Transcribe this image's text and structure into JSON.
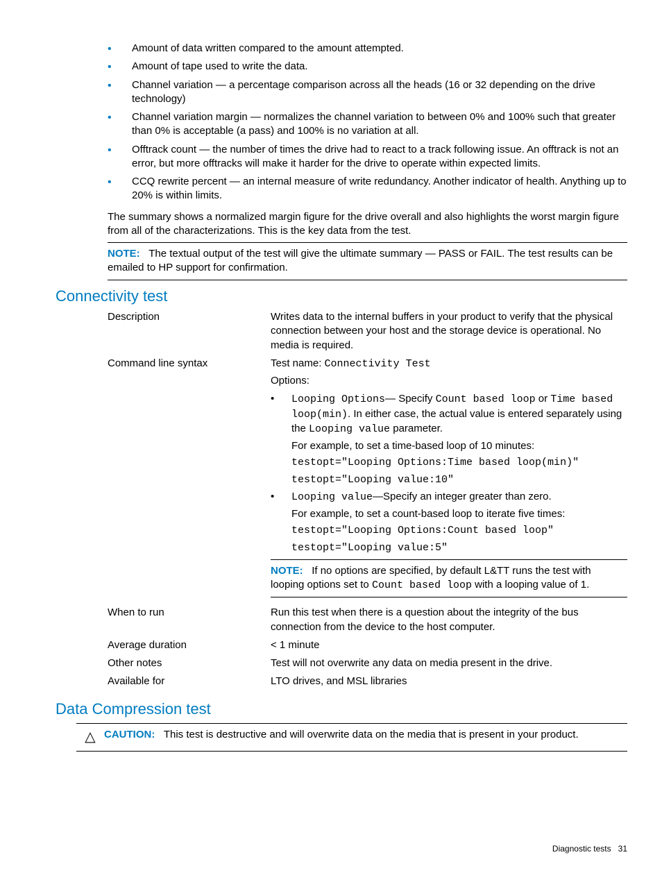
{
  "bullets": [
    "Amount of data written compared to the amount attempted.",
    "Amount of tape used to write the data.",
    "Channel variation — a percentage comparison across all the heads (16 or 32 depending on the drive technology)",
    "Channel variation margin — normalizes the channel variation to between 0% and 100% such that greater than 0% is acceptable (a pass) and 100% is no variation at all.",
    "Offtrack count — the number of times the drive had to react to a track following issue. An offtrack is not an error, but more offtracks will make it harder for the drive to operate within expected limits.",
    "CCQ rewrite percent — an internal measure of write redundancy. Another indicator of health. Anything up to 20% is within limits."
  ],
  "summary": "The summary shows a normalized margin figure for the drive overall and also highlights the worst margin figure from all of the characterizations. This is the key data from the test.",
  "note1": {
    "label": "NOTE:",
    "text": "The textual output of the test will give the ultimate summary — PASS or FAIL. The test results can be emailed to HP support for confirmation."
  },
  "conn": {
    "heading": "Connectivity test",
    "desc_label": "Description",
    "desc_value": "Writes data to the internal buffers in your product to verify that the physical connection between your host and the storage device is operational. No media is required.",
    "cmd_label": "Command line syntax",
    "cmd_line1_a": "Test name: ",
    "cmd_line1_b": "Connectivity Test",
    "cmd_line2": "Options:",
    "opt1": {
      "a": "Looping Options",
      "b": "— Specify ",
      "c": "Count based loop",
      "d": " or ",
      "e": "Time based loop(min)",
      "f": ". In either case, the actual value is entered separately using the ",
      "g": "Looping value",
      "h": " parameter.",
      "ex_intro": "For example, to set a time-based loop of 10 minutes:",
      "ex1": "testopt=\"Looping Options:Time based loop(min)\"",
      "ex2": "testopt=\"Looping value:10\""
    },
    "opt2": {
      "a": "Looping value",
      "b": "—Specify an integer greater than zero.",
      "ex_intro": "For example, to set a count-based loop to iterate five times:",
      "ex1": "testopt=\"Looping Options:Count based loop\"",
      "ex2": "testopt=\"Looping value:5\""
    },
    "note": {
      "label": "NOTE:",
      "a": "If no options are specified, by default L&TT runs the test with looping options set to ",
      "b": "Count based loop",
      "c": " with a looping value of 1."
    },
    "when_label": "When to run",
    "when_value": "Run this test when there is a question about the integrity of the bus connection from the device to the host computer.",
    "dur_label": "Average duration",
    "dur_value": "< 1 minute",
    "notes_label": "Other notes",
    "notes_value": "Test will not overwrite any data on media present in the drive.",
    "avail_label": "Available for",
    "avail_value": "LTO drives, and MSL libraries"
  },
  "dct": {
    "heading": "Data Compression test",
    "caution_label": "CAUTION:",
    "caution_text": "This test is destructive and will overwrite data on the media that is present in your product."
  },
  "footer": {
    "section": "Diagnostic tests",
    "page": "31"
  }
}
